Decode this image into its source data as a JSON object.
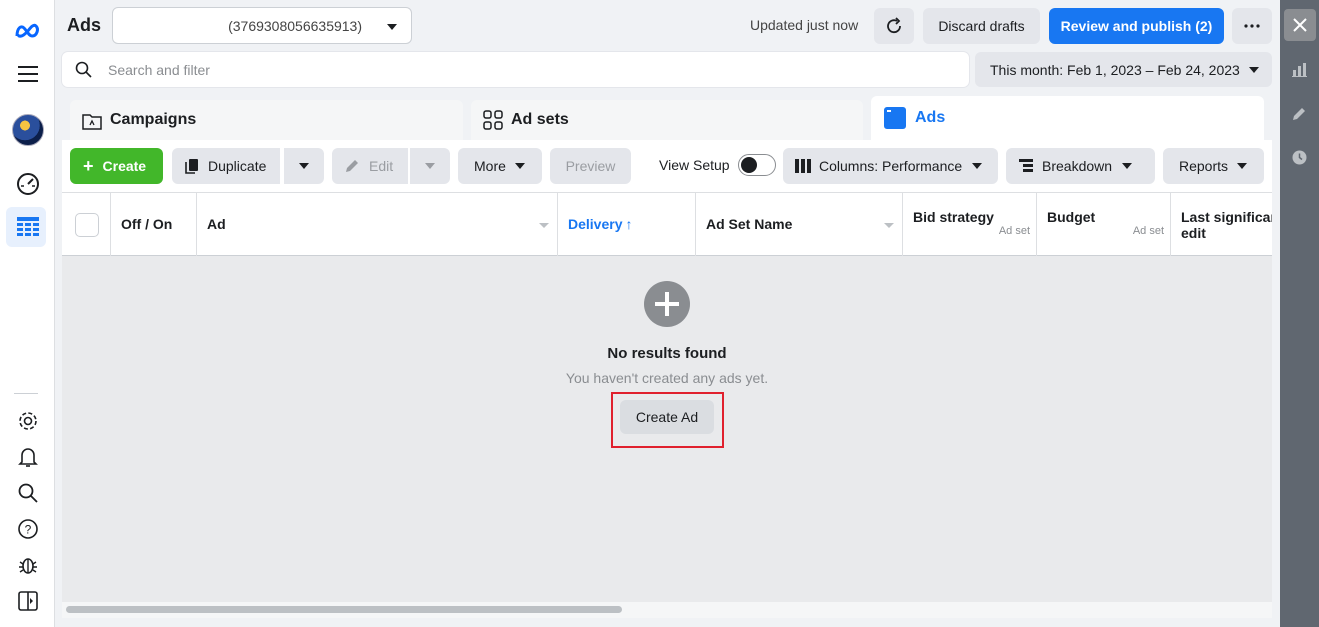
{
  "header": {
    "title": "Ads",
    "account_id": "(3769308056635913)",
    "updated": "Updated just now",
    "discard_label": "Discard drafts",
    "publish_label": "Review and publish (2)"
  },
  "search": {
    "placeholder": "Search and filter"
  },
  "date_range": "This month: Feb 1, 2023 – Feb 24, 2023",
  "tabs": [
    {
      "label": "Campaigns",
      "active": false
    },
    {
      "label": "Ad sets",
      "active": false
    },
    {
      "label": "Ads",
      "active": true
    }
  ],
  "toolbar": {
    "create": "Create",
    "duplicate": "Duplicate",
    "edit": "Edit",
    "more": "More",
    "preview": "Preview",
    "view_setup": "View Setup",
    "columns": "Columns: Performance",
    "breakdown": "Breakdown",
    "reports": "Reports"
  },
  "table": {
    "columns": [
      {
        "label": "Off / On",
        "sub": ""
      },
      {
        "label": "Ad",
        "sub": ""
      },
      {
        "label": "Delivery",
        "sub": "",
        "sorted": "asc"
      },
      {
        "label": "Ad Set Name",
        "sub": ""
      },
      {
        "label": "Bid strategy",
        "sub": "Ad set"
      },
      {
        "label": "Budget",
        "sub": "Ad set"
      },
      {
        "label": "Last significan\nedit",
        "sub": ""
      }
    ]
  },
  "empty": {
    "title": "No results found",
    "subtitle": "You haven't created any ads yet.",
    "button": "Create Ad"
  },
  "colors": {
    "accent": "#1877f2",
    "create": "#42b72a",
    "highlight": "#e0202e"
  }
}
